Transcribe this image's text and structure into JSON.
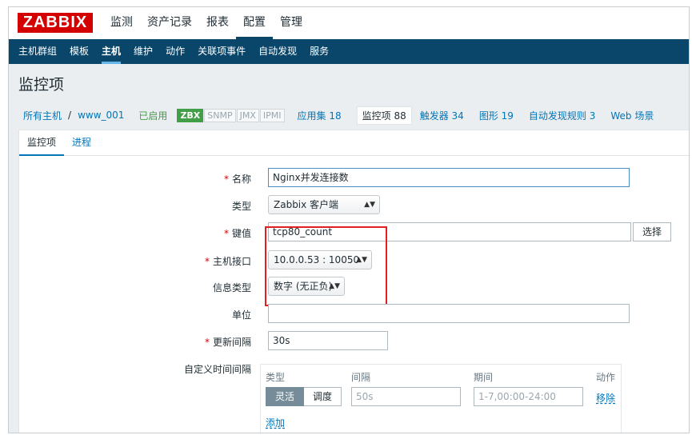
{
  "header": {
    "logo": "ZABBIX",
    "menu": [
      {
        "label": "监测"
      },
      {
        "label": "资产记录"
      },
      {
        "label": "报表"
      },
      {
        "label": "配置"
      },
      {
        "label": "管理"
      }
    ],
    "active_menu": "配置"
  },
  "submenu": {
    "items": [
      {
        "label": "主机群组"
      },
      {
        "label": "模板"
      },
      {
        "label": "主机"
      },
      {
        "label": "维护"
      },
      {
        "label": "动作"
      },
      {
        "label": "关联项事件"
      },
      {
        "label": "自动发现"
      },
      {
        "label": "服务"
      }
    ],
    "active": "主机"
  },
  "page": {
    "title": "监控项"
  },
  "breadcrumb": {
    "all_hosts": "所有主机",
    "separator": "/",
    "host": "www_001",
    "status": "已启用",
    "tags": {
      "zbx": "ZBX",
      "snmp": "SNMP",
      "jmx": "JMX",
      "ipmi": "IPMI"
    },
    "apps": "应用集 18",
    "items": "监控项 88",
    "triggers": "触发器 34",
    "graphs": "图形 19",
    "discovery": "自动发现规则 3",
    "web": "Web 场景"
  },
  "tabs": {
    "item": "监控项",
    "process": "进程"
  },
  "form": {
    "name": {
      "label": "名称",
      "value": "Nginx并发连接数"
    },
    "type": {
      "label": "类型",
      "value": "Zabbix 客户端"
    },
    "key": {
      "label": "键值",
      "value": "tcp80_count",
      "select_button": "选择"
    },
    "interface": {
      "label": "主机接口",
      "value": "10.0.0.53 : 10050"
    },
    "info_type": {
      "label": "信息类型",
      "value": "数字 (无正负)"
    },
    "units": {
      "label": "单位",
      "value": ""
    },
    "interval": {
      "label": "更新间隔",
      "value": "30s"
    },
    "custom_intervals": {
      "label": "自定义时间间隔",
      "headers": {
        "type": "类型",
        "interval": "间隔",
        "period": "期间",
        "action": "动作"
      },
      "mode_flexible": "灵活",
      "mode_scheduling": "调度",
      "interval_placeholder": "50s",
      "period_placeholder": "1-7,00:00-24:00",
      "remove": "移除",
      "add": "添加"
    }
  },
  "colors": {
    "brand": "#d40000",
    "nav": "#0a466a",
    "link": "#0275b8",
    "enabled": "#429e47",
    "highlight": "#e02020"
  }
}
